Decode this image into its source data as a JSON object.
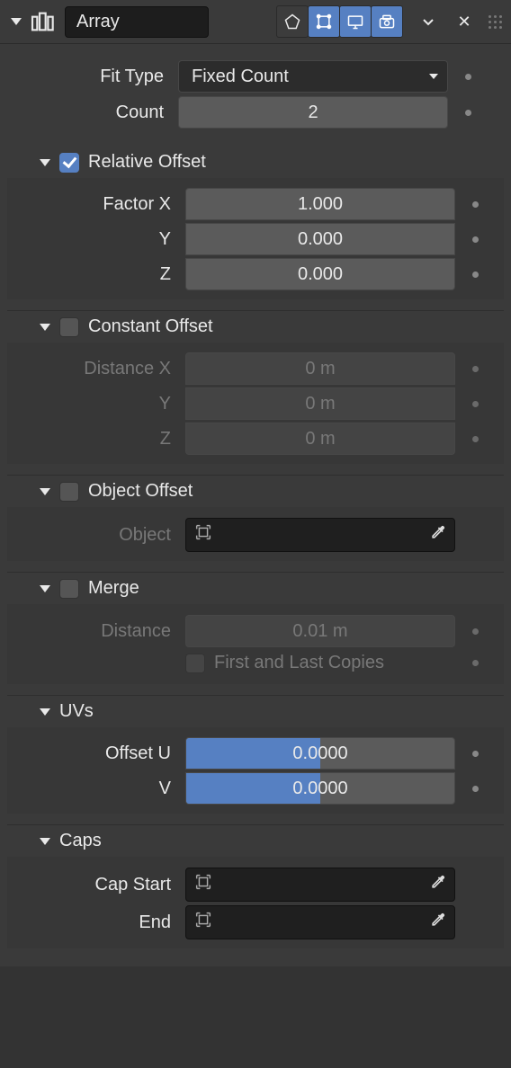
{
  "modifier": {
    "name": "Array",
    "fit_type_label": "Fit Type",
    "fit_type_value": "Fixed Count",
    "count_label": "Count",
    "count_value": "2"
  },
  "relative_offset": {
    "title": "Relative Offset",
    "checked": true,
    "x_label": "Factor X",
    "y_label": "Y",
    "z_label": "Z",
    "x": "1.000",
    "y": "0.000",
    "z": "0.000"
  },
  "constant_offset": {
    "title": "Constant Offset",
    "checked": false,
    "x_label": "Distance X",
    "y_label": "Y",
    "z_label": "Z",
    "x": "0 m",
    "y": "0 m",
    "z": "0 m"
  },
  "object_offset": {
    "title": "Object Offset",
    "checked": false,
    "object_label": "Object"
  },
  "merge": {
    "title": "Merge",
    "checked": false,
    "distance_label": "Distance",
    "distance": "0.01 m",
    "first_last_label": "First and Last Copies"
  },
  "uvs": {
    "title": "UVs",
    "u_label": "Offset U",
    "v_label": "V",
    "u": "0.0000",
    "v": "0.0000"
  },
  "caps": {
    "title": "Caps",
    "start_label": "Cap Start",
    "end_label": "End"
  }
}
